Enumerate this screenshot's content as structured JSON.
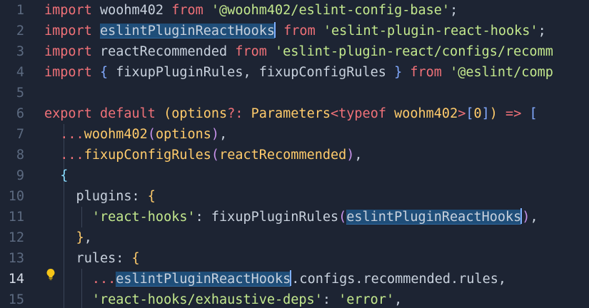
{
  "colors": {
    "background": "#1d2433",
    "keyword": "#f07178",
    "string": "#c3e88d",
    "identifier": "#c8d1dd",
    "function": "#82aaff",
    "type": "#ffcb6b",
    "bracket_yellow": "#ffcb6b",
    "bracket_green": "#89ddff",
    "bracket_purple": "#c792ea",
    "match_highlight": "#1f4e79"
  },
  "editor": {
    "active_line": 14,
    "lines": [
      {
        "n": "1",
        "tokens": [
          {
            "t": "import",
            "c": "kw"
          },
          {
            "t": " woohm402 ",
            "c": "id"
          },
          {
            "t": "from",
            "c": "kw"
          },
          {
            "t": " ",
            "c": "id"
          },
          {
            "t": "'@woohm402/eslint-config-base'",
            "c": "str"
          },
          {
            "t": ";",
            "c": "id"
          }
        ]
      },
      {
        "n": "2",
        "tokens": [
          {
            "t": "import",
            "c": "kw"
          },
          {
            "t": " ",
            "c": "id"
          },
          {
            "t": "eslintPluginReactHooks",
            "c": "id",
            "hl": true,
            "cursor": true
          },
          {
            "t": " ",
            "c": "id"
          },
          {
            "t": "from",
            "c": "kw"
          },
          {
            "t": " ",
            "c": "id"
          },
          {
            "t": "'eslint-plugin-react-hooks'",
            "c": "str"
          },
          {
            "t": ";",
            "c": "id"
          }
        ]
      },
      {
        "n": "3",
        "tokens": [
          {
            "t": "import",
            "c": "kw"
          },
          {
            "t": " reactRecommended ",
            "c": "id"
          },
          {
            "t": "from",
            "c": "kw"
          },
          {
            "t": " ",
            "c": "id"
          },
          {
            "t": "'eslint-plugin-react/configs/recomm",
            "c": "str"
          }
        ]
      },
      {
        "n": "4",
        "tokens": [
          {
            "t": "import",
            "c": "kw"
          },
          {
            "t": " ",
            "c": "id"
          },
          {
            "t": "{",
            "c": "fn"
          },
          {
            "t": " fixupPluginRules, fixupConfigRules ",
            "c": "id"
          },
          {
            "t": "}",
            "c": "fn"
          },
          {
            "t": " ",
            "c": "id"
          },
          {
            "t": "from",
            "c": "kw"
          },
          {
            "t": " ",
            "c": "id"
          },
          {
            "t": "'@eslint/comp",
            "c": "str"
          }
        ]
      },
      {
        "n": "5",
        "tokens": []
      },
      {
        "n": "6",
        "tokens": [
          {
            "t": "export",
            "c": "kw"
          },
          {
            "t": " ",
            "c": "id"
          },
          {
            "t": "default",
            "c": "kw"
          },
          {
            "t": " ",
            "c": "id"
          },
          {
            "t": "(",
            "c": "by"
          },
          {
            "t": "options",
            "c": "ty"
          },
          {
            "t": "?: ",
            "c": "kw"
          },
          {
            "t": "Parameters",
            "c": "ty"
          },
          {
            "t": "<",
            "c": "kw"
          },
          {
            "t": "typeof",
            "c": "kw"
          },
          {
            "t": " woohm402",
            "c": "ty"
          },
          {
            "t": ">",
            "c": "kw"
          },
          {
            "t": "[",
            "c": "fn"
          },
          {
            "t": "0",
            "c": "ty"
          },
          {
            "t": "]",
            "c": "fn"
          },
          {
            "t": ")",
            "c": "by"
          },
          {
            "t": " => ",
            "c": "kw"
          },
          {
            "t": "[",
            "c": "fn"
          }
        ]
      },
      {
        "n": "7",
        "tokens": [
          {
            "t": "  ",
            "c": "id"
          },
          {
            "t": "...",
            "c": "kw"
          },
          {
            "t": "woohm402",
            "c": "ty"
          },
          {
            "t": "(",
            "c": "pp"
          },
          {
            "t": "options",
            "c": "ty"
          },
          {
            "t": ")",
            "c": "pp"
          },
          {
            "t": ",",
            "c": "id"
          }
        ]
      },
      {
        "n": "8",
        "tokens": [
          {
            "t": "  ",
            "c": "id"
          },
          {
            "t": "...",
            "c": "kw"
          },
          {
            "t": "fixupConfigRules",
            "c": "ty"
          },
          {
            "t": "(",
            "c": "pp"
          },
          {
            "t": "reactRecommended",
            "c": "ty"
          },
          {
            "t": ")",
            "c": "pp"
          },
          {
            "t": ",",
            "c": "id"
          }
        ]
      },
      {
        "n": "9",
        "tokens": [
          {
            "t": "  ",
            "c": "id"
          },
          {
            "t": "{",
            "c": "gr"
          }
        ]
      },
      {
        "n": "10",
        "tokens": [
          {
            "t": "    plugins: ",
            "c": "id"
          },
          {
            "t": "{",
            "c": "by"
          }
        ]
      },
      {
        "n": "11",
        "tokens": [
          {
            "t": "      ",
            "c": "id"
          },
          {
            "t": "'react-hooks'",
            "c": "str"
          },
          {
            "t": ": fixupPluginRules",
            "c": "id"
          },
          {
            "t": "(",
            "c": "pp"
          },
          {
            "t": "eslintPluginReactHooks",
            "c": "id",
            "hl": true,
            "cursor": true
          },
          {
            "t": ")",
            "c": "pp"
          },
          {
            "t": ",",
            "c": "id"
          }
        ]
      },
      {
        "n": "12",
        "tokens": [
          {
            "t": "    ",
            "c": "id"
          },
          {
            "t": "}",
            "c": "by"
          },
          {
            "t": ",",
            "c": "id"
          }
        ]
      },
      {
        "n": "13",
        "tokens": [
          {
            "t": "    rules: ",
            "c": "id"
          },
          {
            "t": "{",
            "c": "by"
          }
        ]
      },
      {
        "n": "14",
        "tokens": [
          {
            "t": "      ",
            "c": "id"
          },
          {
            "t": "...",
            "c": "kw"
          },
          {
            "t": "eslintPluginReactHooks",
            "c": "id",
            "hl": true,
            "cursor": true
          },
          {
            "t": ".configs.recommended.rules,",
            "c": "id"
          }
        ]
      },
      {
        "n": "15",
        "tokens": [
          {
            "t": "      ",
            "c": "id"
          },
          {
            "t": "'react-hooks/exhaustive-deps'",
            "c": "str"
          },
          {
            "t": ": ",
            "c": "id"
          },
          {
            "t": "'error'",
            "c": "str"
          },
          {
            "t": ",",
            "c": "id"
          }
        ]
      }
    ]
  },
  "lightbulb": {
    "icon": "lightbulb-icon",
    "line": 14
  }
}
